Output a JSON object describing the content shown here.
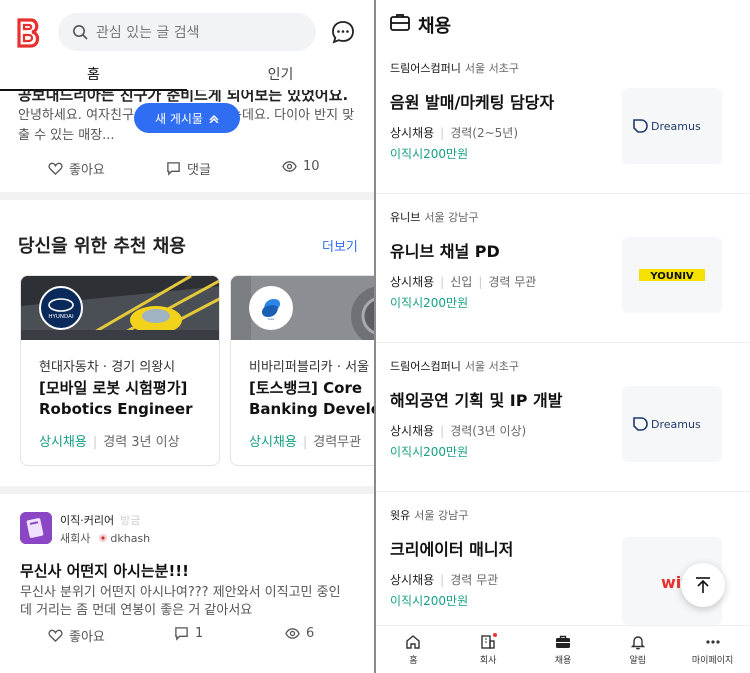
{
  "left": {
    "search": {
      "placeholder": "관심 있는 글 검색"
    },
    "tabs": [
      {
        "label": "홈"
      },
      {
        "label": "인기"
      }
    ],
    "post1": {
      "title_cut": "공보내드리아는 친구가 준비드게 되어보는 있었어요.",
      "body": "안녕하세요. 여자친구                하나 해주려고 하는데요.  다이아 반지               맞출 수 있는 매장...",
      "likes_label": "좋아요",
      "comments_label": "댓글",
      "views": "10"
    },
    "new_post_button": "새 게시물",
    "recommend": {
      "title": "당신을 위한 추천 채용",
      "more": "더보기",
      "cards": [
        {
          "logo": "HYUNDAI",
          "company": "현대자동차 · 경기 의왕시",
          "title_line1": "[모바일 로봇 시험평가]",
          "title_line2": "Robotics Engineer",
          "type": "상시채용",
          "career": "경력 3년 이상"
        },
        {
          "logo": "toss",
          "company": "비바리퍼블리카 · 서울",
          "title_line1": "[토스뱅크] Core",
          "title_line2": "Banking Develop",
          "type": "상시채용",
          "career": "경력무관"
        }
      ]
    },
    "post2": {
      "author": "이직·커리어",
      "follow": "방금",
      "company": "새회사",
      "user": "dkhash",
      "title": "무신사 어떤지 아시는분!!!",
      "body": "무신사 분위기 어떤지 아시나여??? 제안와서 이직고민 중인데 거리는 좀 먼데 연봉이 좋은 거 같아서요",
      "likes_label": "좋아요",
      "comments": "1",
      "views": "6"
    }
  },
  "right": {
    "header_title": "채용",
    "listings": [
      {
        "company": "드림어스컴퍼니",
        "location": "서울 서초구",
        "title": "음원 발매/마케팅 담당자",
        "type": "상시채용",
        "meta": [
          "경력(2~5년)"
        ],
        "bonus": "이직시200만원",
        "logo": "Dreamus"
      },
      {
        "company": "유니브",
        "location": "서울 강남구",
        "title": "유니브 채널 PD",
        "type": "상시채용",
        "meta": [
          "신입",
          "경력 무관"
        ],
        "bonus": "이직시200만원",
        "logo": "YOUNIV"
      },
      {
        "company": "드림어스컴퍼니",
        "location": "서울 서초구",
        "title": "해외공연 기획 및 IP 개발",
        "type": "상시채용",
        "meta": [
          "경력(3년 이상)"
        ],
        "bonus": "이직시200만원",
        "logo": "Dreamus"
      },
      {
        "company": "윗유",
        "location": "서울 강남구",
        "title": "크리에이터 매니저",
        "type": "상시채용",
        "meta": [
          "경력 무관"
        ],
        "bonus": "이직시200만원",
        "logo": "wit"
      }
    ],
    "nav": [
      {
        "label": "홈",
        "icon": "home-icon"
      },
      {
        "label": "회사",
        "icon": "company-icon"
      },
      {
        "label": "채용",
        "icon": "briefcase-icon"
      },
      {
        "label": "알림",
        "icon": "bell-icon"
      },
      {
        "label": "마이페이지",
        "icon": "more-icon"
      }
    ]
  },
  "colors": {
    "accent": "#2f6ef2",
    "brand": "#e8312f",
    "green": "#16a085"
  }
}
